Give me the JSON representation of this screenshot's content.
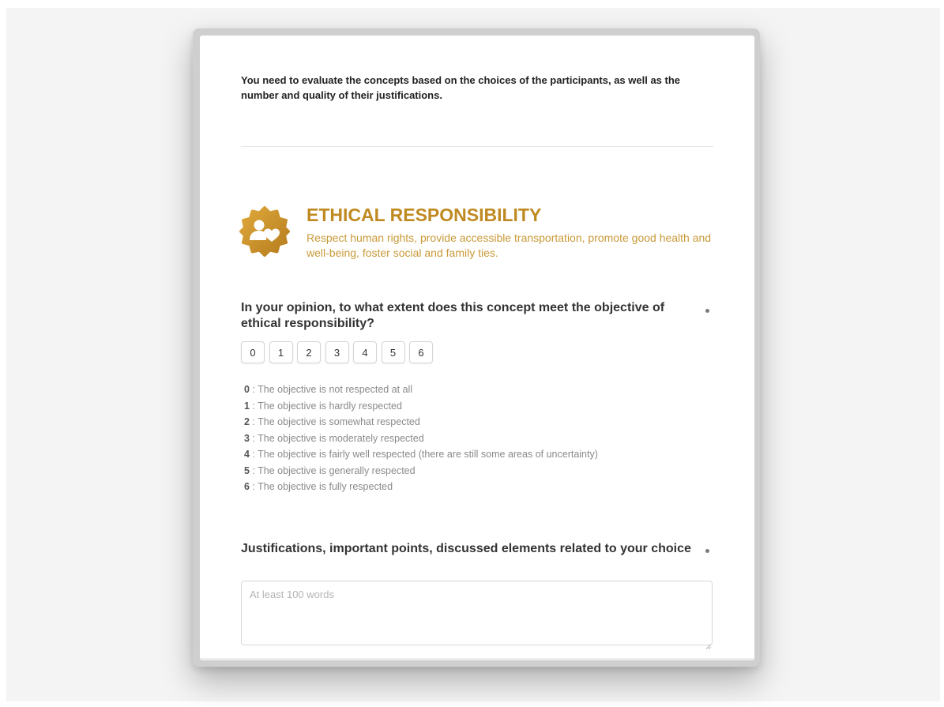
{
  "intro_text": "You need to evaluate the concepts based on the choices of the participants, as well as the number and quality of their justifications.",
  "section": {
    "title": "ETHICAL RESPONSIBILITY",
    "description": "Respect human rights, provide accessible transportation, promote good health and well-being, foster social and family ties.",
    "icon": "people-heart-badge-icon",
    "accent_color": "#c08a22"
  },
  "question1": {
    "label": "In your opinion, to what extent does this concept meet the objective of ethical responsibility?",
    "required": true,
    "scale": [
      "0",
      "1",
      "2",
      "3",
      "4",
      "5",
      "6"
    ],
    "legend": [
      {
        "key": "0",
        "text": "The objective is not respected at all"
      },
      {
        "key": "1",
        "text": "The objective is hardly respected"
      },
      {
        "key": "2",
        "text": "The objective is somewhat respected"
      },
      {
        "key": "3",
        "text": "The objective is moderately respected"
      },
      {
        "key": "4",
        "text": "The objective is fairly well respected (there are still some areas of uncertainty)"
      },
      {
        "key": "5",
        "text": "The objective is generally respected"
      },
      {
        "key": "6",
        "text": "The objective is fully respected"
      }
    ]
  },
  "question2": {
    "label": "Justifications, important points, discussed elements related to your choice",
    "required": true,
    "placeholder": "At least 100 words",
    "value": ""
  }
}
